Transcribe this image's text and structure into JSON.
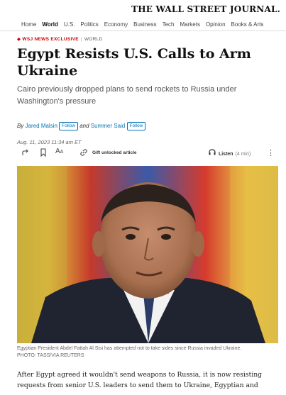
{
  "masthead": "THE WALL STREET JOURNAL.",
  "nav": {
    "items": [
      "Home",
      "World",
      "U.S.",
      "Politics",
      "Economy",
      "Business",
      "Tech",
      "Markets",
      "Opinion",
      "Books & Arts"
    ]
  },
  "kicker": {
    "badge": "WSJ NEWS EXCLUSIVE",
    "section": "WORLD"
  },
  "headline": "Egypt Resists U.S. Calls to Arm Ukraine",
  "dek": "Cairo previously dropped plans to send rockets to Russia under Washington's pressure",
  "byline": {
    "by": "By",
    "author1": "Jared Malsin",
    "and": "and",
    "author2": "Summer Said",
    "follow": "Follow"
  },
  "date": "Aug. 11, 2023 11:34 am ET",
  "toolbar": {
    "gift": "Gift unlocked article",
    "listen": "Listen",
    "duration": "(4 min)"
  },
  "caption": {
    "text": "Egyptian President Abdel Fattah Al Sisi has attempted not to take sides since Russia invaded Ukraine.",
    "credit": "PHOTO: TASS/VIA REUTERS"
  },
  "body": "After Egypt agreed it wouldn't send weapons to Russia, it is now resisting requests from senior U.S. leaders to send them to Ukraine, Egyptian and",
  "colors": {
    "accent": "#0274b6",
    "exclusive": "#cc0000"
  }
}
